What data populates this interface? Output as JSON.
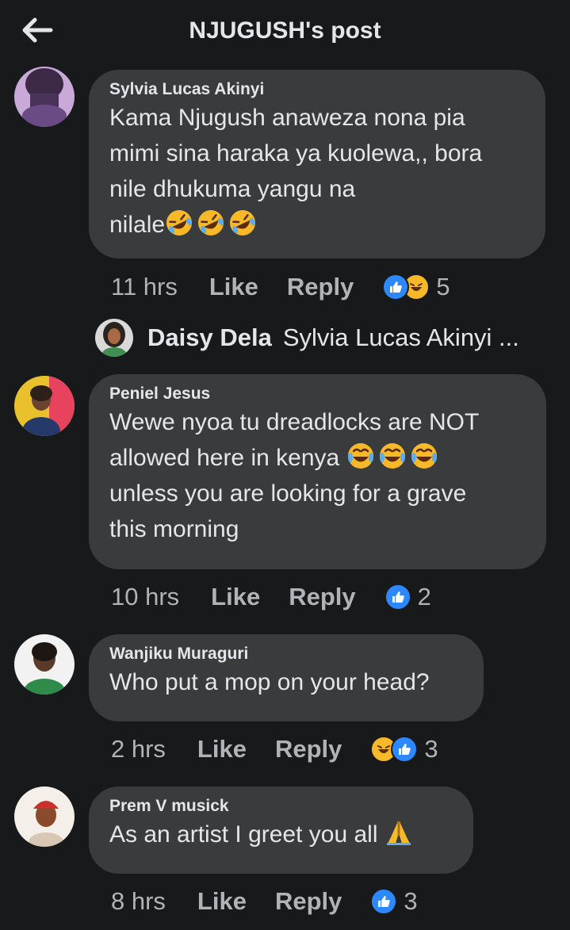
{
  "header": {
    "title": "NJUGUSH's post",
    "back_icon": "arrow-left-icon"
  },
  "comments": [
    {
      "author": "Sylvia Lucas Akinyi",
      "lines": [
        "Kama Njugush anaweza nona pia",
        "mimi sina haraka ya kuolewa,, bora",
        "nile dhukuma yangu na",
        "nilale"
      ],
      "time": "11 hrs",
      "like": "Like",
      "reply": "Reply",
      "reaction_count": "5",
      "reactions": [
        "like",
        "haha"
      ]
    },
    {
      "author": "Peniel Jesus",
      "lines": [
        "Wewe nyoa tu dreadlocks are  NOT",
        "allowed here in kenya",
        "unless you are looking for a grave",
        "this morning"
      ],
      "time": "10 hrs",
      "like": "Like",
      "reply": "Reply",
      "reaction_count": "2",
      "reactions": [
        "like"
      ]
    },
    {
      "author": "Wanjiku Muraguri",
      "lines": [
        "Who put a mop on your head?"
      ],
      "time": "2 hrs",
      "like": "Like",
      "reply": "Reply",
      "reaction_count": "3",
      "reactions": [
        "haha",
        "like"
      ]
    },
    {
      "author": "Prem V musick",
      "lines": [
        "As an artist I greet you all"
      ],
      "time": "8 hrs",
      "like": "Like",
      "reply": "Reply",
      "reaction_count": "3",
      "reactions": [
        "like"
      ]
    }
  ],
  "reply_preview": {
    "author": "Daisy Dela",
    "text": "Sylvia Lucas Akinyi ..."
  },
  "colors": {
    "background": "#18191a",
    "bubble": "#3a3b3c",
    "like_blue": "#2d88ff",
    "haha_yellow": "#f7b928",
    "muted": "#b0b3b8"
  }
}
